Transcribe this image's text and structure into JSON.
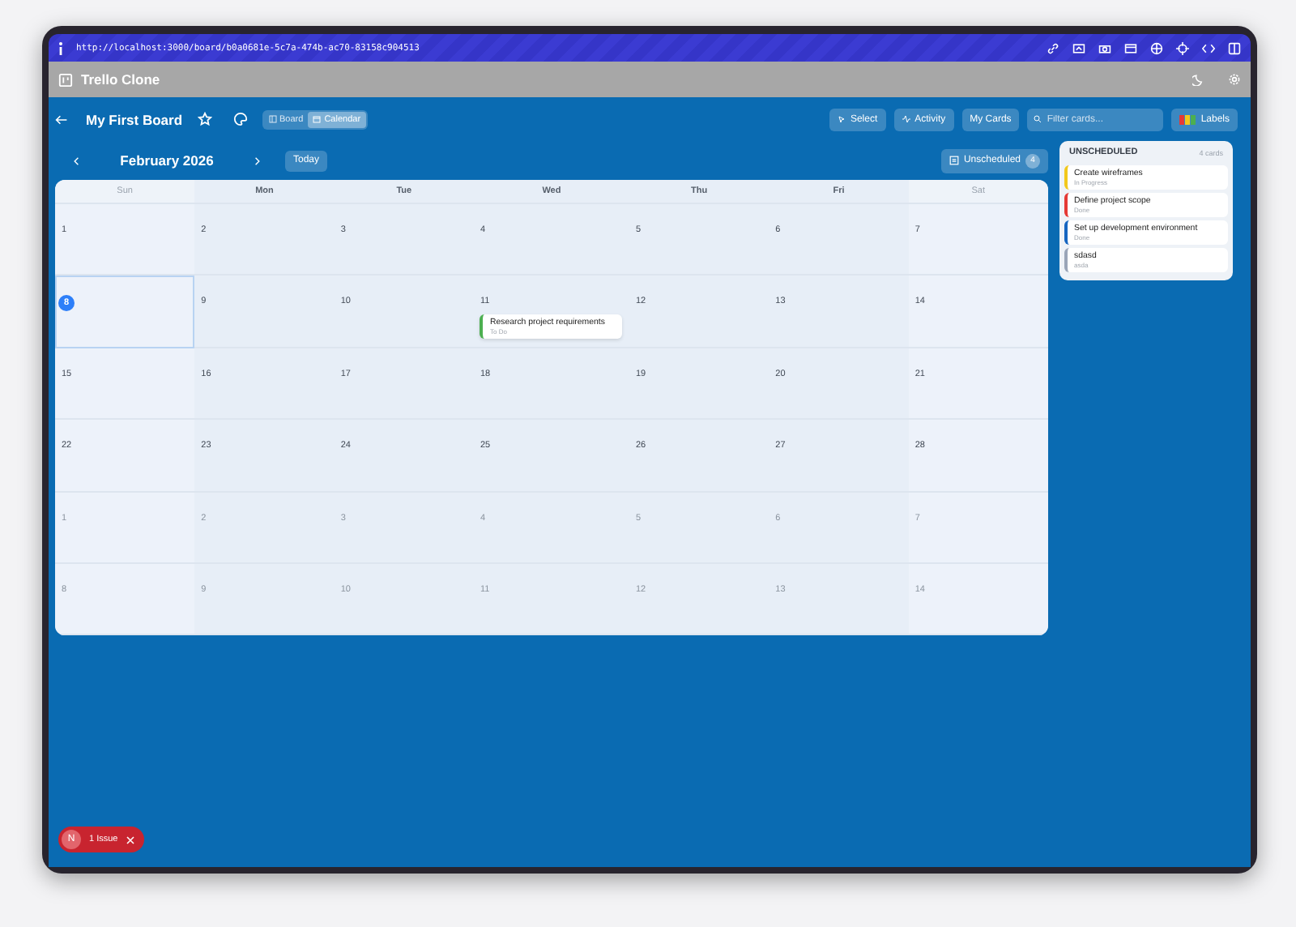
{
  "address_bar": {
    "url": "http://localhost:3000/board/b0a0681e-5c7a-474b-ac70-83158c904513"
  },
  "app_header": {
    "title": "Trello Clone"
  },
  "board_toolbar": {
    "title": "My First Board",
    "view_tabs": [
      {
        "label": "Board",
        "selected": false
      },
      {
        "label": "Calendar",
        "selected": true
      }
    ],
    "buttons": [
      "Select",
      "Activity",
      "My Cards"
    ],
    "filter": {
      "placeholder": "Filter cards..."
    },
    "labels_button": "Labels"
  },
  "calendar_nav": {
    "month": "February 2026",
    "today_button": "Today",
    "unscheduled_button": {
      "label": "Unscheduled",
      "count": "4"
    }
  },
  "calendar": {
    "weekdays": [
      "Sun",
      "Mon",
      "Tue",
      "Wed",
      "Thu",
      "Fri",
      "Sat"
    ],
    "days": [
      {
        "day": "1",
        "muted": false,
        "today": false
      },
      {
        "day": "2",
        "muted": false,
        "today": false
      },
      {
        "day": "3",
        "muted": false,
        "today": false
      },
      {
        "day": "4",
        "muted": false,
        "today": false
      },
      {
        "day": "5",
        "muted": false,
        "today": false
      },
      {
        "day": "6",
        "muted": false,
        "today": false
      },
      {
        "day": "7",
        "muted": false,
        "today": false
      },
      {
        "day": "8",
        "muted": false,
        "today": true
      },
      {
        "day": "9",
        "muted": false,
        "today": false
      },
      {
        "day": "10",
        "muted": false,
        "today": false
      },
      {
        "day": "11",
        "muted": false,
        "today": false,
        "events": [
          {
            "title": "Research project requirements",
            "status": "To Do",
            "color": "#4caf50"
          }
        ]
      },
      {
        "day": "12",
        "muted": false,
        "today": false
      },
      {
        "day": "13",
        "muted": false,
        "today": false
      },
      {
        "day": "14",
        "muted": false,
        "today": false
      },
      {
        "day": "15",
        "muted": false,
        "today": false
      },
      {
        "day": "16",
        "muted": false,
        "today": false
      },
      {
        "day": "17",
        "muted": false,
        "today": false
      },
      {
        "day": "18",
        "muted": false,
        "today": false
      },
      {
        "day": "19",
        "muted": false,
        "today": false
      },
      {
        "day": "20",
        "muted": false,
        "today": false
      },
      {
        "day": "21",
        "muted": false,
        "today": false
      },
      {
        "day": "22",
        "muted": false,
        "today": false
      },
      {
        "day": "23",
        "muted": false,
        "today": false
      },
      {
        "day": "24",
        "muted": false,
        "today": false
      },
      {
        "day": "25",
        "muted": false,
        "today": false
      },
      {
        "day": "26",
        "muted": false,
        "today": false
      },
      {
        "day": "27",
        "muted": false,
        "today": false
      },
      {
        "day": "28",
        "muted": false,
        "today": false
      },
      {
        "day": "1",
        "muted": true,
        "today": false
      },
      {
        "day": "2",
        "muted": true,
        "today": false
      },
      {
        "day": "3",
        "muted": true,
        "today": false
      },
      {
        "day": "4",
        "muted": true,
        "today": false
      },
      {
        "day": "5",
        "muted": true,
        "today": false
      },
      {
        "day": "6",
        "muted": true,
        "today": false
      },
      {
        "day": "7",
        "muted": true,
        "today": false
      },
      {
        "day": "8",
        "muted": true,
        "today": false
      },
      {
        "day": "9",
        "muted": true,
        "today": false
      },
      {
        "day": "10",
        "muted": true,
        "today": false
      },
      {
        "day": "11",
        "muted": true,
        "today": false
      },
      {
        "day": "12",
        "muted": true,
        "today": false
      },
      {
        "day": "13",
        "muted": true,
        "today": false
      },
      {
        "day": "14",
        "muted": true,
        "today": false
      }
    ]
  },
  "unscheduled_panel": {
    "title": "UNSCHEDULED",
    "count": "4 cards",
    "cards": [
      {
        "title": "Create wireframes",
        "status": "In Progress",
        "color": "#f2c81b"
      },
      {
        "title": "Define project scope",
        "status": "Done",
        "color": "#e53935"
      },
      {
        "title": "Set up development environment",
        "status": "Done",
        "color": "#1565c0"
      },
      {
        "title": "sdasd",
        "status": "asda",
        "color": "#9aa5b8"
      }
    ]
  },
  "issue_badge": {
    "initial": "N",
    "label": "1 Issue"
  }
}
